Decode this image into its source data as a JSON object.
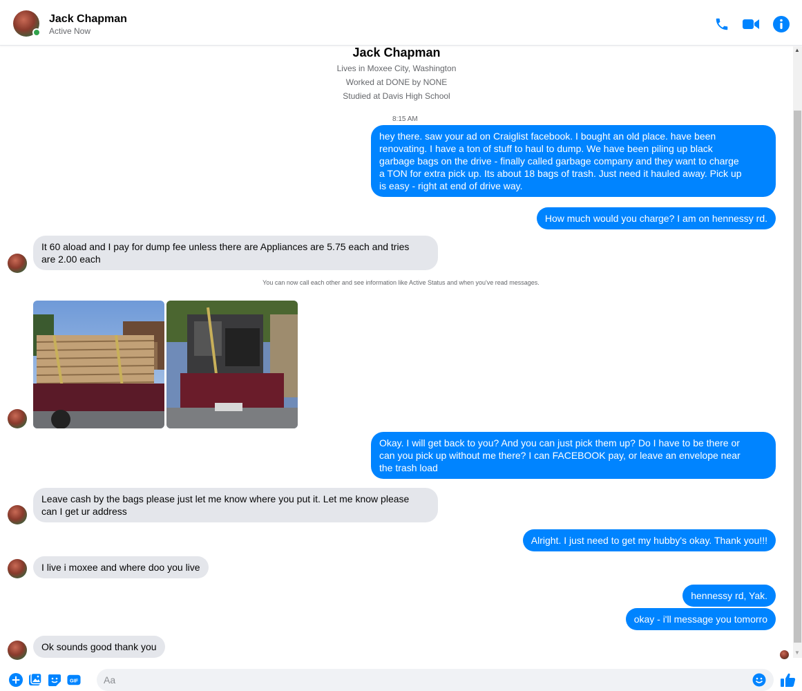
{
  "header": {
    "name": "Jack Chapman",
    "status": "Active Now",
    "accent": "#0084ff",
    "icons": [
      "phone-icon",
      "video-camera-icon",
      "info-icon"
    ]
  },
  "profile": {
    "name": "Jack Chapman",
    "lives": "Lives in Moxee City, Washington",
    "worked": "Worked at DONE by NONE",
    "studied": "Studied at Davis High School"
  },
  "conversation": {
    "timestamp": "8:15 AM",
    "messages": [
      {
        "from": "me",
        "text": "hey there. saw your ad on Craiglist facebook. I bought an old place. have been\nrenovating. I have a ton of stuff to haul to dump. We have been piling up black\ngarbage bags on the drive - finally called garbage company and they want to charge\na TON for extra pick up. Its about 18 bags of trash. Just need it hauled away. Pick up\nis easy - right at end of drive way."
      },
      {
        "from": "me",
        "text": "How much would you charge? I am on hennessy rd."
      },
      {
        "from": "them",
        "text": "It 60 aload and I pay for dump fee unless there are Appliances are 5.75 each and tries\nare 2.00 each"
      },
      {
        "from": "them",
        "type": "photos",
        "count": 2
      },
      {
        "from": "me",
        "text": "Okay. I will get back to you? And you can just pick them up? Do I have to be there or\ncan you pick up without me there? I can FACEBOOK pay, or leave an envelope near\nthe trash load"
      },
      {
        "from": "them",
        "text": "Leave cash by the bags please just let me know where you put it. Let me know please\ncan I get ur address"
      },
      {
        "from": "me",
        "text": "Alright. I just need to get my hubby's okay. Thank you!!!"
      },
      {
        "from": "them",
        "text": "I live i moxee and where doo you live"
      },
      {
        "from": "me",
        "text": "hennessy rd, Yak."
      },
      {
        "from": "me",
        "text": "okay - i'll message you tomorro"
      },
      {
        "from": "them",
        "text": "Ok sounds good thank you"
      }
    ],
    "system_note": "You can now call each other and see information like\nActive Status and when you've read messages."
  },
  "composer": {
    "placeholder": "Aa",
    "value": "",
    "icons": [
      "plus-icon",
      "image-icon",
      "sticker-icon",
      "gif-icon",
      "emoji-icon",
      "thumbs-up-icon"
    ],
    "gif_label": "GIF"
  }
}
